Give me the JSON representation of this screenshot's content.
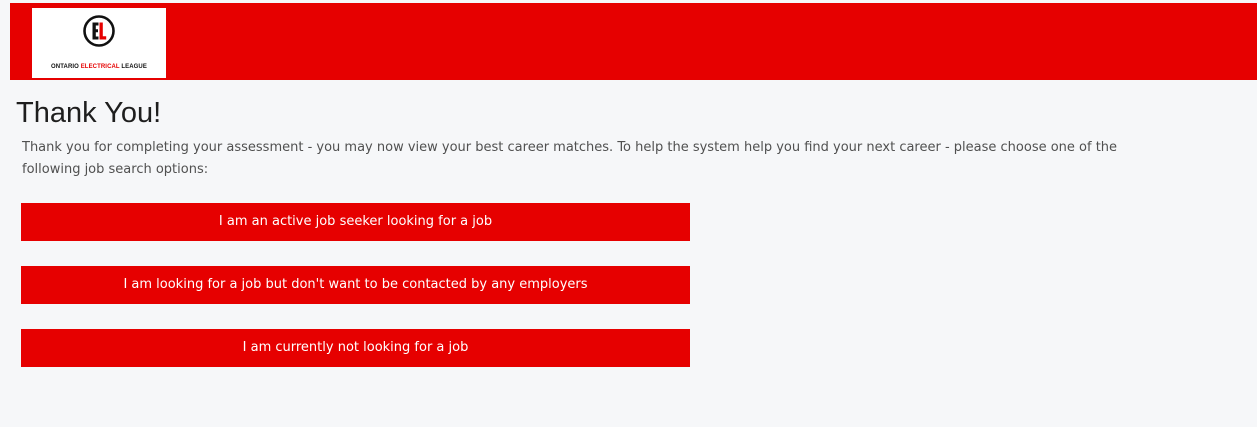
{
  "header": {
    "logo": {
      "icon": "el-monogram-icon",
      "text_part1": "ONTARIO ",
      "text_part2": "ELECTRICAL",
      "text_part3": " LEAGUE"
    }
  },
  "main": {
    "title": "Thank You!",
    "intro": "Thank you for completing your assessment - you may now view your best career matches. To help the system help you find your next career - please choose one of the following job search options:",
    "options": [
      {
        "label": "I am an active job seeker looking for a job"
      },
      {
        "label": "I am looking for a job but don't want to be contacted by any employers"
      },
      {
        "label": "I am currently not looking for a job"
      }
    ]
  },
  "colors": {
    "brand_red": "#e60000",
    "page_background": "#f6f7f9",
    "title_text": "#1e1e1e",
    "body_text": "#505050"
  }
}
